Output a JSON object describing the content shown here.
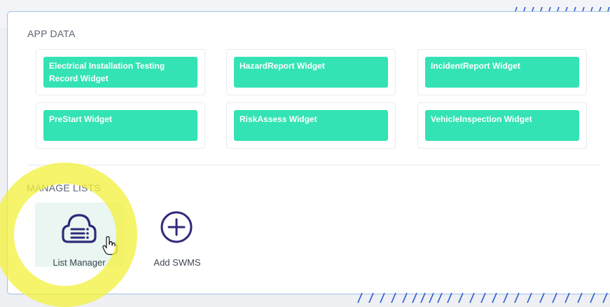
{
  "app_data": {
    "title": "APP DATA",
    "widgets": [
      {
        "label": "Electrical Installation Testing Record Widget"
      },
      {
        "label": "HazardReport Widget"
      },
      {
        "label": "IncidentReport Widget"
      },
      {
        "label": "PreStart Widget"
      },
      {
        "label": "RiskAssess Widget"
      },
      {
        "label": "VehicleInspection Widget"
      }
    ]
  },
  "manage_lists": {
    "title": "MANAGE LISTS",
    "items": [
      {
        "label": "List Manager",
        "icon": "cloud-list-icon"
      },
      {
        "label": "Add SWMS",
        "icon": "plus-circle-icon"
      }
    ]
  },
  "colors": {
    "widget_accent": "#33e3b4",
    "icon_accent": "#2f2a7a",
    "highlight": "#f4f140",
    "panel_border": "#9fc1ea"
  }
}
